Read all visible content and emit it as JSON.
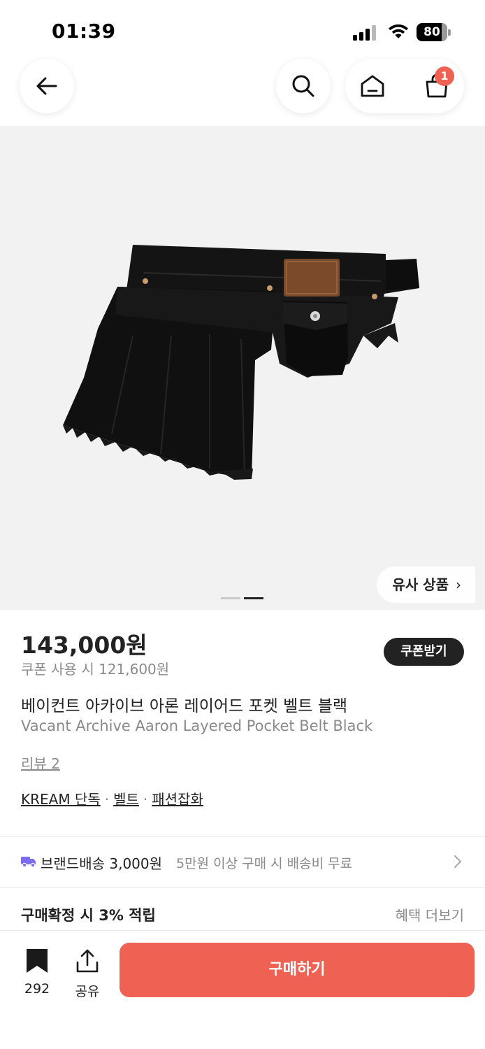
{
  "status_bar": {
    "time": "01:39",
    "battery": "80"
  },
  "nav": {
    "cart_count": "1"
  },
  "image": {
    "similar_label": "유사 상품",
    "similar_chevron": "›"
  },
  "product": {
    "price": "143,000원",
    "coupon_price": "쿠폰 사용 시 121,600원",
    "coupon_button": "쿠폰받기",
    "name_ko": "베이컨트 아카이브 아론 레이어드 포켓 벨트 블랙",
    "name_en": "Vacant Archive Aaron Layered Pocket Belt Black",
    "review_link": "리뷰 2",
    "tags": [
      "KREAM 단독",
      "벨트",
      "패션잡화"
    ],
    "tag_separator": "·"
  },
  "delivery": {
    "label": "브랜드배송 3,000원",
    "note": "5만원 이상 구매 시 배송비 무료"
  },
  "points": {
    "label": "구매확정 시 3% 적립",
    "more": "혜택 더보기"
  },
  "bottom": {
    "bookmark_count": "292",
    "share_label": "공유",
    "buy_label": "구매하기"
  },
  "colors": {
    "accent": "#ef6253",
    "text": "#222222",
    "muted": "#8a8a8a",
    "image_bg": "#f2f2f2",
    "truck": "#7b6cf0"
  }
}
